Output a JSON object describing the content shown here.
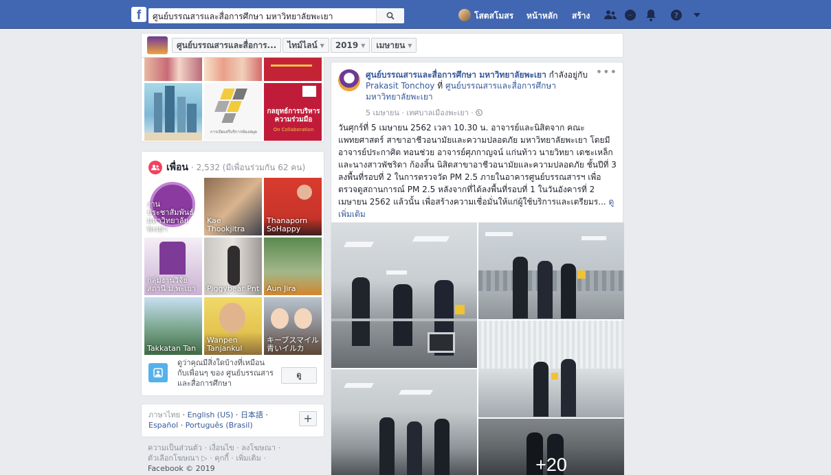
{
  "topbar": {
    "logo": "f",
    "search_value": "ศูนย์บรรณสารและสื่อการศึกษา มหาวิทยาลัยพะเยา",
    "user_name": "โสตสโมสร",
    "home": "หน้าหลัก",
    "create": "สร้าง",
    "icons": [
      "friends-icon",
      "messenger-icon",
      "notifications-icon",
      "help-icon",
      "menu-caret-icon"
    ]
  },
  "page_nav": {
    "page_name": "ศูนย์บรรณสารและสื่อการ...",
    "timeline": "ไทม์ไลน์",
    "year": "2019",
    "month": "เมษายน"
  },
  "photos": {
    "tile3_text": "กลยุทธ์การบริหาร ความร่วมมือ",
    "tile3_sub": "On Collaboration",
    "tile2_text": "การเปิดเสรีบริการห้องสมุด"
  },
  "friends": {
    "title": "เพื่อน",
    "count": "· 2,532 (มีเพื่อนร่วมกัน 62 คน)",
    "items": [
      {
        "name": "งานประชาสัมพันธ์ มหาวิทยาลัยพะเยา"
      },
      {
        "name": "Kae Thookjitra"
      },
      {
        "name": "Thanaporn SoHappy"
      },
      {
        "name": "กลุ่มงานวิจัยสถานี ม.พะเยา"
      },
      {
        "name": "Piggybear Pnt"
      },
      {
        "name": "Aun Jira"
      },
      {
        "name": "Takkatan Tan"
      },
      {
        "name": "Wanpen Tanjankul"
      },
      {
        "name": "キーブスマイル青いイルカ"
      }
    ],
    "suggest_text": "ดูว่าคุณมีสิ่งใดบ้างที่เหมือนกับเพื่อนๆ ของ ศูนย์บรรณสารและสื่อการศึกษา",
    "suggest_button": "ดู"
  },
  "languages": {
    "current": "ภาษาไทย",
    "links": [
      "English (US)",
      "日本語",
      "Español",
      "Português (Brasil)"
    ]
  },
  "footer": {
    "line1": "ความเป็นส่วนตัว · เงื่อนไข · ลงโฆษณา ·",
    "line2": "ตัวเลือกโฆษณา ▷ · คุกกี้ · เพิ่มเติม ·",
    "copyright": "Facebook © 2019"
  },
  "post": {
    "author": "ศูนย์บรรณสารและสื่อการศึกษา มหาวิทยาลัยพะเยา",
    "action1": "กำลังอยู่กับ",
    "with": "Prakasit Tonchoy",
    "action2": "ที่",
    "place": "ศูนย์บรรณสารและสื่อการศึกษา มหาวิทยาลัยพะเยา",
    "meta": "5 เมษายน · เทศบาลเมืองพะเยา · ",
    "text": "วันศุกร์ที่ 5 เมษายน 2562 เวลา 10.30 น. อาจารย์และนิสิตจาก คณะแพทยศาสตร์ สาขาอาชีวอนามัยและความปลอดภัย มหาวิทยาลัยพะเยา โดยมี อาจารย์ประกาศิต ทอนช่วย อาจารย์ศุภกาญจน์ แก่นท้าว นายวิทยา เดชะเหล็ก และนางสาวพัชริดา ก้องสิ้น นิสิตสาขาอาชีวอนามัยและความปลอดภัย ชั้นปีที่ 3 ลงพื้นที่รอบที่ 2 ในการตรวจวัด PM 2.5 ภายในอาคารศูนย์บรรณสารฯ เพื่อตรวจดูสถานการณ์ PM 2.5 หลังจากที่ได้ลงพื้นที่รอบที่ 1 ในวันอังคารที่ 2 เมษายน 2562 แล้วนั้น เพื่อสร้างความเชื่อมั่นให้แก่ผู้ใช้บริการและเตรียมร...",
    "see_more": "ดูเพิ่มเติม",
    "more_photos": "+20"
  }
}
